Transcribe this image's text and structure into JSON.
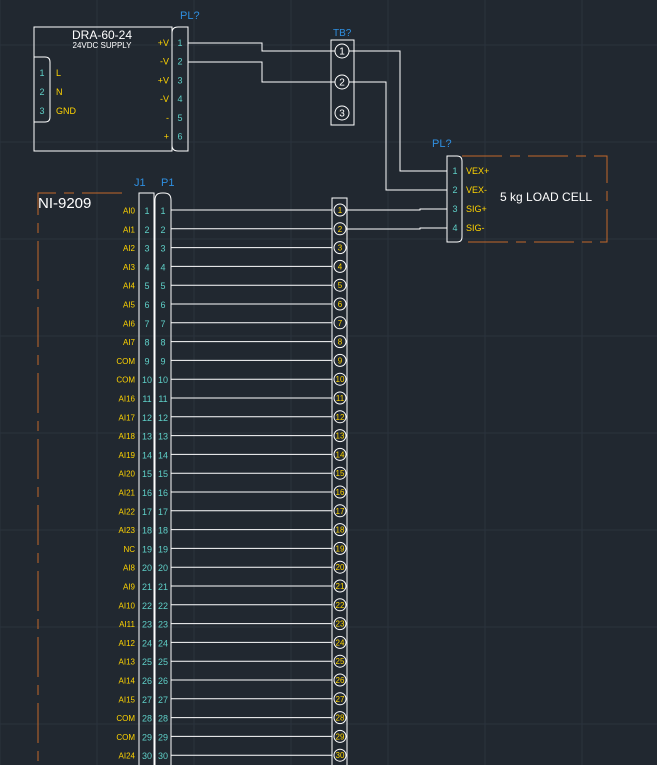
{
  "colors": {
    "background": "#212830",
    "grid": "#2b333d",
    "wire": "#ffffff",
    "pin_label": "#ffd400",
    "pin_number": "#5fd0c8",
    "designator": "#2f8fe0",
    "border": "#c4682a",
    "text": "#ffffff"
  },
  "power_supply": {
    "title": "DRA-60-24",
    "subtitle": "24VDC SUPPLY",
    "designator": "PL?",
    "left_pins": [
      {
        "num": "1",
        "label": "L"
      },
      {
        "num": "2",
        "label": "N"
      },
      {
        "num": "3",
        "label": "GND"
      }
    ],
    "right_pins": [
      {
        "num": "1",
        "label": "+V"
      },
      {
        "num": "2",
        "label": "-V"
      },
      {
        "num": "3",
        "label": "+V"
      },
      {
        "num": "4",
        "label": "-V"
      },
      {
        "num": "5",
        "label": "-"
      },
      {
        "num": "6",
        "label": "+"
      }
    ]
  },
  "terminal_block_top": {
    "designator": "TB?",
    "terminals": [
      "1",
      "2",
      "3"
    ]
  },
  "load_cell": {
    "title": "5 kg LOAD CELL",
    "designator": "PL?",
    "pins": [
      {
        "num": "1",
        "label": "VEX+"
      },
      {
        "num": "2",
        "label": "VEX-"
      },
      {
        "num": "3",
        "label": "SIG+"
      },
      {
        "num": "4",
        "label": "SIG-"
      }
    ]
  },
  "ni_module": {
    "title": "NI-9209",
    "j_designator": "J1",
    "p_designator": "P1",
    "pins": [
      {
        "label": "AI0",
        "num": "1"
      },
      {
        "label": "AI1",
        "num": "2"
      },
      {
        "label": "AI2",
        "num": "3"
      },
      {
        "label": "AI3",
        "num": "4"
      },
      {
        "label": "AI4",
        "num": "5"
      },
      {
        "label": "AI5",
        "num": "6"
      },
      {
        "label": "AI6",
        "num": "7"
      },
      {
        "label": "AI7",
        "num": "8"
      },
      {
        "label": "COM",
        "num": "9"
      },
      {
        "label": "COM",
        "num": "10"
      },
      {
        "label": "AI16",
        "num": "11"
      },
      {
        "label": "AI17",
        "num": "12"
      },
      {
        "label": "AI18",
        "num": "13"
      },
      {
        "label": "AI19",
        "num": "14"
      },
      {
        "label": "AI20",
        "num": "15"
      },
      {
        "label": "AI21",
        "num": "16"
      },
      {
        "label": "AI22",
        "num": "17"
      },
      {
        "label": "AI23",
        "num": "18"
      },
      {
        "label": "NC",
        "num": "19"
      },
      {
        "label": "AI8",
        "num": "20"
      },
      {
        "label": "AI9",
        "num": "21"
      },
      {
        "label": "AI10",
        "num": "22"
      },
      {
        "label": "AI11",
        "num": "23"
      },
      {
        "label": "AI12",
        "num": "24"
      },
      {
        "label": "AI13",
        "num": "25"
      },
      {
        "label": "AI14",
        "num": "26"
      },
      {
        "label": "AI15",
        "num": "27"
      },
      {
        "label": "COM",
        "num": "28"
      },
      {
        "label": "COM",
        "num": "29"
      },
      {
        "label": "AI24",
        "num": "30"
      }
    ]
  }
}
